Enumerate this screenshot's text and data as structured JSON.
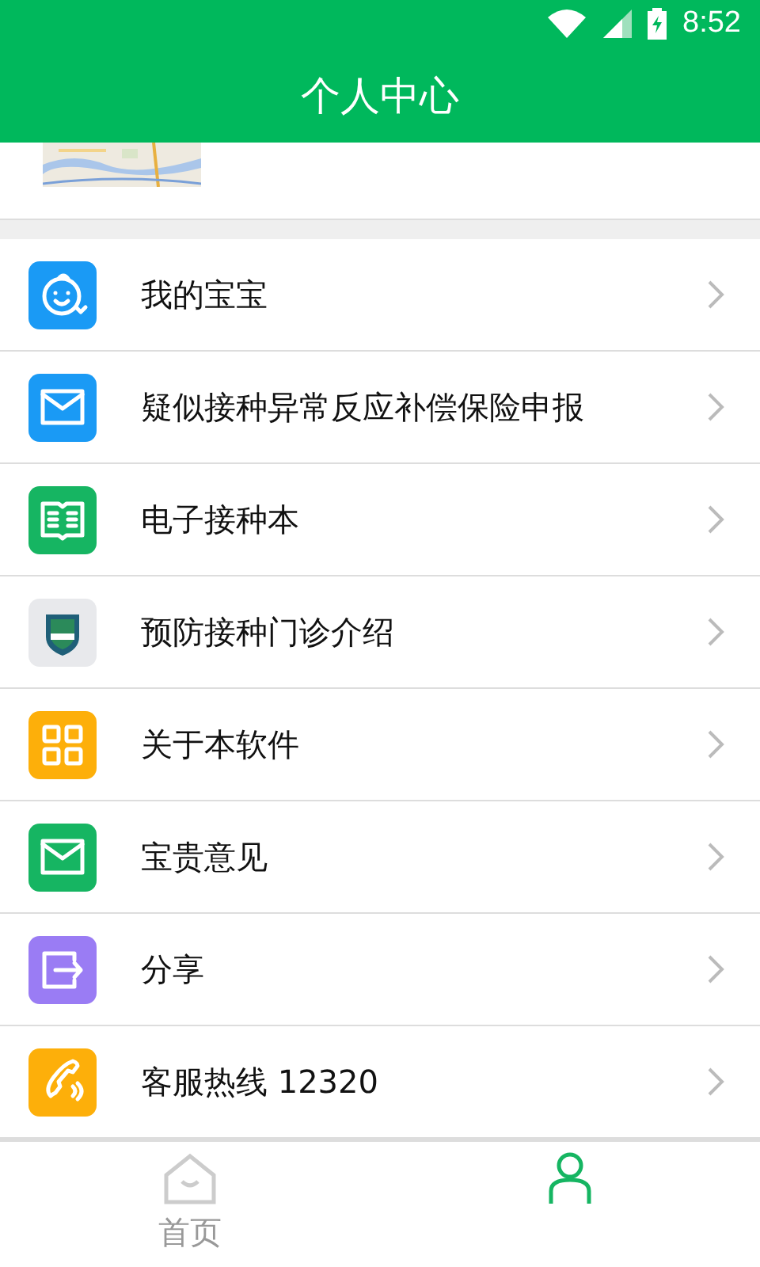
{
  "status_bar": {
    "time": "8:52"
  },
  "title": "个人中心",
  "menu": [
    {
      "label": "我的宝宝",
      "kind": "baby",
      "color": "#1a9af5"
    },
    {
      "label": "疑似接种异常反应补偿保险申报",
      "kind": "mail",
      "color": "#1a9af5"
    },
    {
      "label": "电子接种本",
      "kind": "book",
      "color": "#16b562"
    },
    {
      "label": "预防接种门诊介绍",
      "kind": "shield",
      "color": "#e8e9ec"
    },
    {
      "label": "关于本软件",
      "kind": "grid",
      "color": "#fdaf0a"
    },
    {
      "label": "宝贵意见",
      "kind": "mail",
      "color": "#16b562"
    },
    {
      "label": "分享",
      "kind": "share",
      "color": "#9a7cf4"
    },
    {
      "label": "客服热线 12320",
      "kind": "phone",
      "color": "#fdaf0a"
    }
  ],
  "nav": [
    {
      "label": "首页",
      "kind": "home",
      "selected": false
    },
    {
      "kind": "person",
      "selected": true
    }
  ]
}
